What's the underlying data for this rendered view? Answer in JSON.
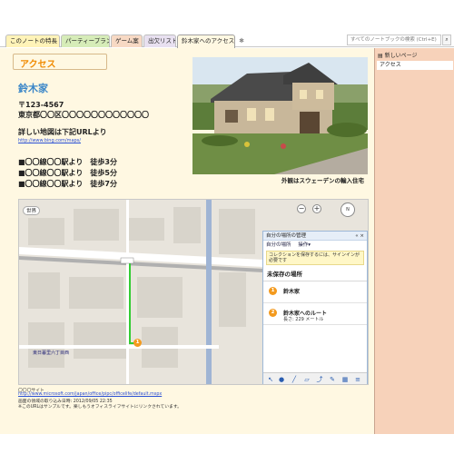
{
  "tabs": [
    {
      "label": "このノートの特長",
      "color": "#fff3b8"
    },
    {
      "label": "パーティープラン",
      "color": "#d6ecb8"
    },
    {
      "label": "ゲーム案",
      "color": "#f7d9c4"
    },
    {
      "label": "出欠リスト",
      "color": "#e8e0f0"
    },
    {
      "label": "鈴木家へのアクセス",
      "color": "#fff8e2"
    }
  ],
  "search": {
    "placeholder": "すべてのノートブックの検索 (Ctrl+E)"
  },
  "page": {
    "title": "アクセス",
    "name": "鈴木家",
    "postal": "〒123-4567",
    "address": "東京都〇〇区〇〇〇〇〇〇〇〇〇〇〇〇",
    "detail": "詳しい地図は下記URLより",
    "url": "http://www.bing.com/maps/",
    "routes": [
      "■〇〇線〇〇駅より　徒歩3分",
      "■〇〇線〇〇駅より　徒歩5分",
      "■〇〇線〇〇駅より　徒歩7分"
    ],
    "photo_caption": "外観はスウェーデンの輸入住宅"
  },
  "map": {
    "world_label": "世界",
    "panel_title": "自分の場所の管理",
    "my_places": "自分の場所",
    "actions": "操作▾",
    "note": "コレクションを保存するには、サインインが必要です",
    "section": "未保存の場所",
    "items": [
      {
        "num": "1",
        "title": "鈴木家",
        "sub": ""
      },
      {
        "num": "2",
        "title": "鈴木家へのルート",
        "sub": "長さ: 229 メートル"
      }
    ]
  },
  "footer": {
    "line1": "〇〇〇サイト",
    "line2": "http://www.microsoft.com/japan/office/pipc/officelife/default.mspx",
    "line3": "画面の領域の取り込み日時: 2012/09/05 22:35",
    "line4": "※このURLはサンプルです。楽しもうオフィスライフサイトにリンクされています。"
  },
  "sidebar": {
    "new_page": "新しいページ",
    "items": [
      "アクセス"
    ]
  }
}
